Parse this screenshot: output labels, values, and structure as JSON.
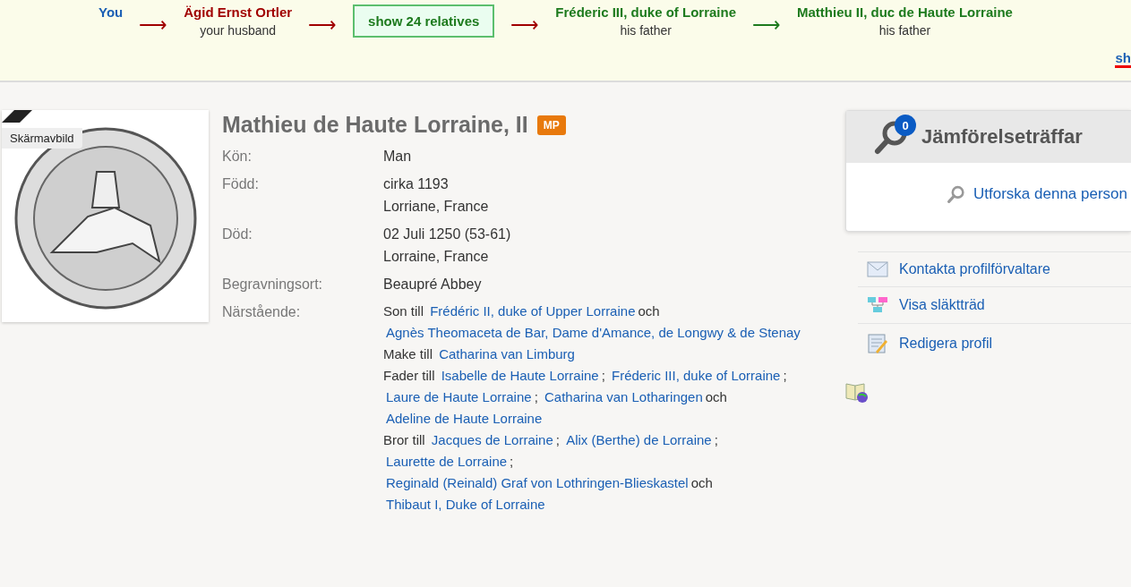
{
  "chain": [
    {
      "kind": "person",
      "name": "You",
      "color": "#1a5fb4"
    },
    {
      "kind": "arrow",
      "symbol": "⟶",
      "color": "#a00000"
    },
    {
      "kind": "person",
      "name": "Ägid Ernst Ortler",
      "relation": "your husband",
      "color": "#a00000"
    },
    {
      "kind": "arrow",
      "symbol": "⟶",
      "color": "#a00000"
    },
    {
      "kind": "button",
      "label": "show 24 relatives"
    },
    {
      "kind": "arrow",
      "symbol": "⟶",
      "color": "#a00000"
    },
    {
      "kind": "person",
      "name": "Fréderic III, duke of Lorraine",
      "relation": "his father",
      "color": "#1d7a1d"
    },
    {
      "kind": "arrow",
      "symbol": "⟶",
      "color": "#1d7a1d"
    },
    {
      "kind": "person",
      "name": "Matthieu II, duc de Haute Lorraine",
      "relation": "his father",
      "color": "#1d7a1d"
    }
  ],
  "chain_more": "sh",
  "photo": {
    "tag": "Skärmavbild"
  },
  "profile": {
    "name": "Mathieu de Haute Lorraine, II",
    "badge": "MP"
  },
  "facts": [
    {
      "label": "Kön:",
      "lines": [
        "Man"
      ]
    },
    {
      "label": "Född:",
      "lines": [
        "cirka 1193",
        "Lorriane, France"
      ]
    },
    {
      "label": "Död:",
      "lines": [
        "02 Juli 1250 (53-61)",
        "Lorraine, France"
      ]
    },
    {
      "label": "Begravningsort:",
      "lines": [
        "Beaupré Abbey"
      ]
    }
  ],
  "relations_label": "Närstående:",
  "relations": [
    {
      "lead": "Son till",
      "parts": [
        {
          "kind": "link",
          "text": "Frédéric II, duke of Upper Lorraine"
        },
        {
          "kind": "text",
          "text": "och"
        },
        {
          "kind": "link",
          "text": "Agnès Theomaceta de Bar, Dame d'Amance, de Longwy & de Stenay"
        }
      ]
    },
    {
      "lead": "Make till",
      "parts": [
        {
          "kind": "link",
          "text": "Catharina van Limburg"
        }
      ]
    },
    {
      "lead": "Fader till",
      "parts": [
        {
          "kind": "link",
          "text": "Isabelle de Haute Lorraine"
        },
        {
          "kind": "text",
          "text": ";"
        },
        {
          "kind": "link",
          "text": "Fréderic III, duke of Lorraine"
        },
        {
          "kind": "text",
          "text": ";"
        },
        {
          "kind": "link",
          "text": "Laure de Haute Lorraine"
        },
        {
          "kind": "text",
          "text": ";"
        },
        {
          "kind": "link",
          "text": "Catharina van Lotharingen"
        },
        {
          "kind": "text",
          "text": "och"
        },
        {
          "kind": "link",
          "text": "Adeline de Haute Lorraine"
        }
      ]
    },
    {
      "lead": "Bror till",
      "parts": [
        {
          "kind": "link",
          "text": "Jacques de Lorraine"
        },
        {
          "kind": "text",
          "text": ";"
        },
        {
          "kind": "link",
          "text": "Alix (Berthe) de Lorraine"
        },
        {
          "kind": "text",
          "text": ";"
        },
        {
          "kind": "link",
          "text": "Laurette de Lorraine"
        },
        {
          "kind": "text",
          "text": ";"
        },
        {
          "kind": "link",
          "text": "Reginald (Reinald) Graf von Lothringen-Blieskastel"
        },
        {
          "kind": "text",
          "text": "och"
        },
        {
          "kind": "link",
          "text": "Thibaut I, Duke of Lorraine"
        }
      ]
    }
  ],
  "matches": {
    "count": "0",
    "title": "Jämförelseträffar",
    "explore": "Utforska denna person"
  },
  "actions": [
    {
      "kind": "mail",
      "label": "Kontakta profilförvaltare"
    },
    {
      "kind": "tree",
      "label": "Visa släktträd"
    },
    {
      "kind": "edit",
      "label": "Redigera profil"
    }
  ]
}
